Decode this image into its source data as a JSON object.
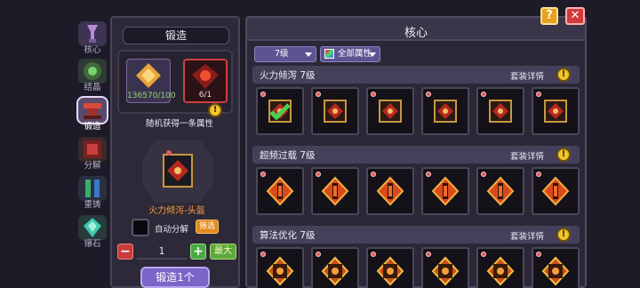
{
  "tabs": [
    {
      "label": "核心",
      "icon": "core-icon",
      "active": false
    },
    {
      "label": "结晶",
      "icon": "crystal-icon",
      "active": false
    },
    {
      "label": "锻造",
      "icon": "anvil-icon",
      "active": true
    },
    {
      "label": "分解",
      "icon": "decompose-icon",
      "active": false
    },
    {
      "label": "重铸",
      "icon": "recast-icon",
      "active": false
    },
    {
      "label": "镶石",
      "icon": "gem-inlay-icon",
      "active": false
    }
  ],
  "forge": {
    "title": "锻造",
    "material_1_count": "136570/100",
    "material_2_count": "6/1",
    "random_attr_text": "随机获得一条属性",
    "info_mark": "!",
    "item_name": "火力倾泻-头盔",
    "auto_decompose_label": "自动分解",
    "filter_label": "筛选",
    "minus_label": "−",
    "plus_label": "+",
    "quantity": "1",
    "max_label": "最大",
    "forge_button": "锻造1个"
  },
  "core": {
    "title": "核心",
    "level_filter": "7级",
    "attr_filter": "全部属性",
    "help_label": "?",
    "close_label": "✕",
    "sections": [
      {
        "title": "火力倾泻 7级",
        "detail_label": "套装详情",
        "info_mark": "!",
        "item_icon": "firepower-core-icon",
        "first_equipped": true
      },
      {
        "title": "超频过载 7级",
        "detail_label": "套装详情",
        "info_mark": "!",
        "item_icon": "overclock-core-icon",
        "first_equipped": false
      },
      {
        "title": "算法优化 7级",
        "detail_label": "套装详情",
        "info_mark": "!",
        "item_icon": "algorithm-core-icon",
        "first_equipped": false
      }
    ]
  },
  "colors": {
    "accent_orange": "#e28a1c",
    "item_name": "#ff9d35",
    "material_count": "#8bd86a",
    "forge_button": "#7a65c8",
    "close_button": "#d23a3a"
  }
}
